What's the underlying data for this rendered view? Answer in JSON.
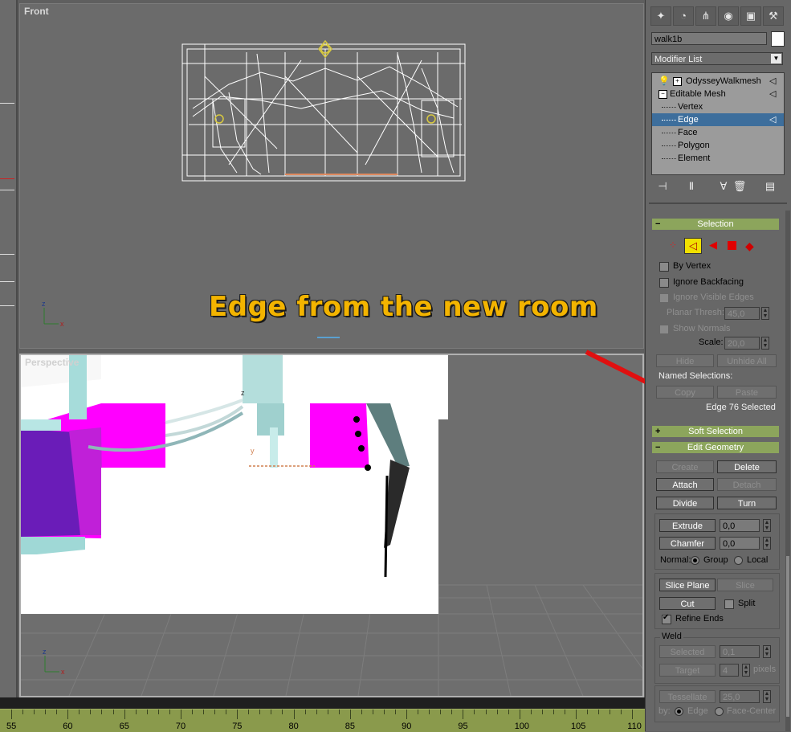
{
  "viewports": {
    "front_label": "Front",
    "perspective_label": "Perspective"
  },
  "annotation": {
    "text": "Edge from the new room",
    "arrow_color": "#e01010",
    "text_color": "#f3b400"
  },
  "ruler": {
    "ticks": [
      "55",
      "60",
      "65",
      "70",
      "75",
      "80",
      "85",
      "90",
      "95",
      "100",
      "105",
      "110"
    ]
  },
  "panel": {
    "tab_icons": [
      "create-icon",
      "modify-icon",
      "hierarchy-icon",
      "motion-icon",
      "display-icon",
      "utilities-icon"
    ],
    "object_name": "walk1b",
    "modifier_list_label": "Modifier List",
    "stack": [
      {
        "label": "OdysseyWalkmesh",
        "indent": 0,
        "selected": false
      },
      {
        "label": "Editable Mesh",
        "indent": 0,
        "selected": false
      },
      {
        "label": "Vertex",
        "indent": 1,
        "selected": false
      },
      {
        "label": "Edge",
        "indent": 1,
        "selected": true
      },
      {
        "label": "Face",
        "indent": 1,
        "selected": false
      },
      {
        "label": "Polygon",
        "indent": 1,
        "selected": false
      },
      {
        "label": "Element",
        "indent": 1,
        "selected": false
      }
    ],
    "selection": {
      "header": "Selection",
      "by_vertex": "By Vertex",
      "ignore_backfacing": "Ignore Backfacing",
      "ignore_visible_edges": "Ignore Visible Edges",
      "planar_thresh_label": "Planar Thresh:",
      "planar_thresh_value": "45,0",
      "show_normals": "Show Normals",
      "scale_label": "Scale:",
      "scale_value": "20,0",
      "hide": "Hide",
      "unhide_all": "Unhide All",
      "named_selections": "Named Selections:",
      "copy": "Copy",
      "paste": "Paste",
      "status": "Edge 76 Selected"
    },
    "soft_selection": {
      "header": "Soft Selection"
    },
    "edit_geometry": {
      "header": "Edit Geometry",
      "create": "Create",
      "delete": "Delete",
      "attach": "Attach",
      "detach": "Detach",
      "divide": "Divide",
      "turn": "Turn",
      "extrude": "Extrude",
      "extrude_value": "0,0",
      "chamfer": "Chamfer",
      "chamfer_value": "0,0",
      "normal_label": "Normal:",
      "group": "Group",
      "local": "Local",
      "slice_plane": "Slice Plane",
      "slice": "Slice",
      "cut": "Cut",
      "split": "Split",
      "refine_ends": "Refine Ends",
      "weld_title": "Weld",
      "selected": "Selected",
      "selected_value": "0,1",
      "target": "Target",
      "target_value": "4",
      "pixels": "pixels",
      "tessellate": "Tessellate",
      "tessellate_value": "25,0",
      "by_label": "by:",
      "edge": "Edge",
      "face_center": "Face-Center"
    }
  }
}
